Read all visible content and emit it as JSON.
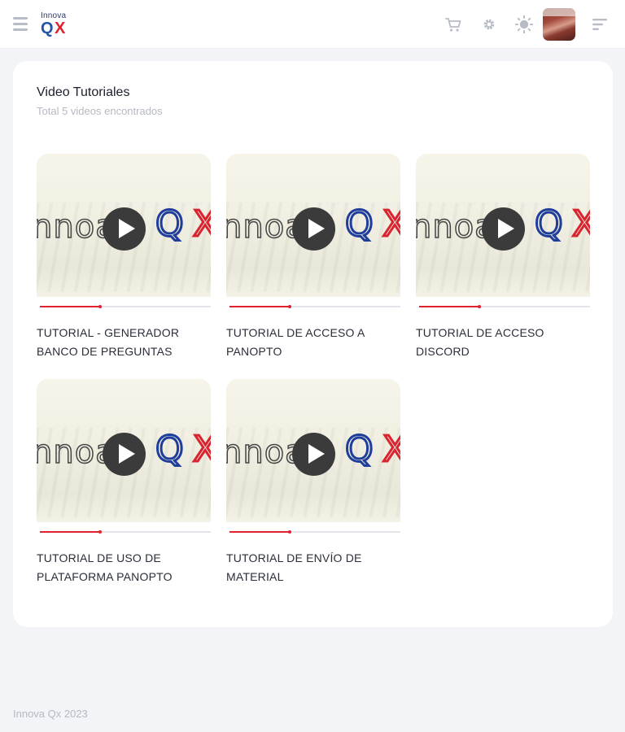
{
  "app": {
    "logo_top": "Innova",
    "logo_q": "Q",
    "logo_x": "X",
    "accent_blue": "#2454a8",
    "accent_red": "#e0222e"
  },
  "topbar": {
    "icons": [
      "menu-icon",
      "cart-icon",
      "gear-icon",
      "sun-icon",
      "avatar",
      "list-menu-icon"
    ]
  },
  "page": {
    "title": "Video Tutoriales",
    "subtitle": "Total 5 videos encontrados"
  },
  "videos": [
    {
      "title": "TUTORIAL - GENERADOR BANCO DE PREGUNTAS",
      "progress": 0.35,
      "thumb_word": "nnoa",
      "thumb_q": "Q",
      "thumb_x": "X"
    },
    {
      "title": "TUTORIAL DE ACCESO A PANOPTO",
      "progress": 0.35,
      "thumb_word": "nnoa",
      "thumb_q": "Q",
      "thumb_x": "X"
    },
    {
      "title": "TUTORIAL DE ACCESO DISCORD",
      "progress": 0.35,
      "thumb_word": "nnoa",
      "thumb_q": "Q",
      "thumb_x": "X"
    },
    {
      "title": "TUTORIAL DE USO DE PLATAFORMA PANOPTO",
      "progress": 0.35,
      "thumb_word": "nnoa",
      "thumb_q": "Q",
      "thumb_x": "X"
    },
    {
      "title": "TUTORIAL DE ENVÍO DE MATERIAL",
      "progress": 0.35,
      "thumb_word": "nnoa",
      "thumb_q": "Q",
      "thumb_x": "X"
    }
  ],
  "footer": {
    "text": "Innova Qx 2023"
  }
}
